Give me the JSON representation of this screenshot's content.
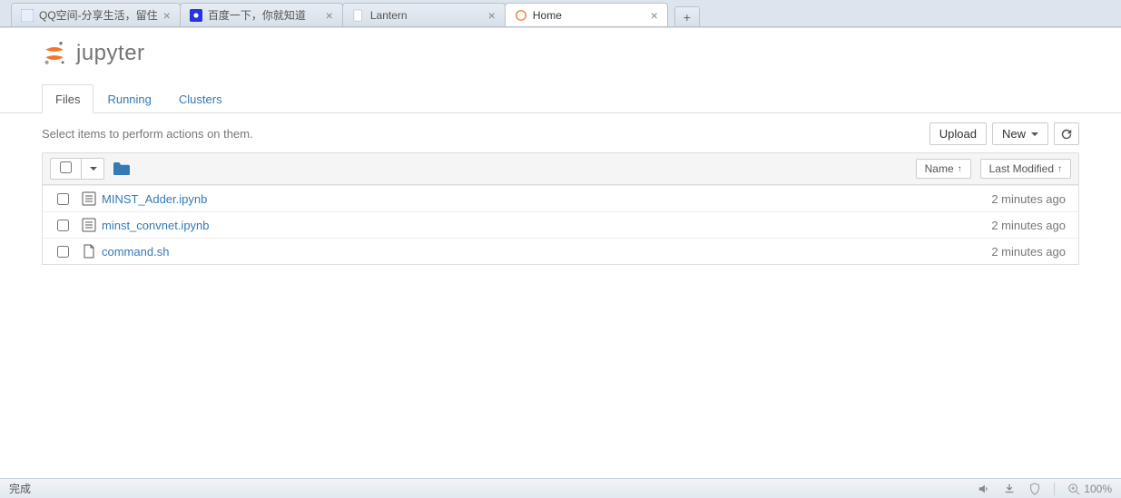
{
  "browser": {
    "tabs": [
      {
        "label": "QQ空间-分享生活，留住",
        "fav": "qq"
      },
      {
        "label": "百度一下，你就知道",
        "fav": "baidu"
      },
      {
        "label": "Lantern",
        "fav": "page"
      },
      {
        "label": "Home",
        "fav": "jupyter",
        "active": true
      }
    ],
    "newtab": "+"
  },
  "logo": {
    "text": "jupyter"
  },
  "nav": {
    "tabs": [
      {
        "label": "Files",
        "active": true
      },
      {
        "label": "Running"
      },
      {
        "label": "Clusters"
      }
    ]
  },
  "toolbar": {
    "instruction": "Select items to perform actions on them.",
    "upload": "Upload",
    "new": "New",
    "refresh": "↻"
  },
  "header": {
    "sort_name": "Name",
    "sort_modified": "Last Modified"
  },
  "files": [
    {
      "name": "MINST_Adder.ipynb",
      "type": "notebook",
      "time": "2 minutes ago"
    },
    {
      "name": "minst_convnet.ipynb",
      "type": "notebook",
      "time": "2 minutes ago"
    },
    {
      "name": "command.sh",
      "type": "file",
      "time": "2 minutes ago"
    }
  ],
  "status": {
    "left": "完成",
    "zoom": "100%"
  }
}
